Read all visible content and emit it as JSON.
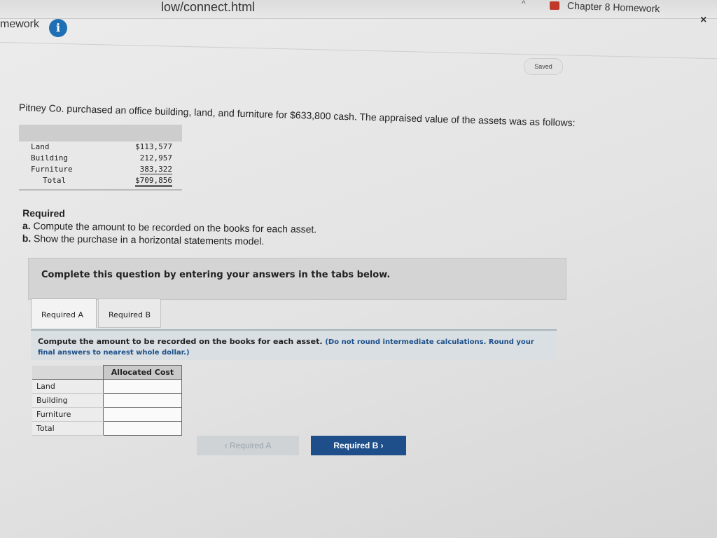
{
  "browser": {
    "url_fragment": "low/connect.html",
    "tab_title": "Chapter 8 Homework",
    "close_symbol": "×"
  },
  "header": {
    "title": "mework",
    "info_symbol": "i",
    "saved_label": "Saved"
  },
  "problem": {
    "statement": "Pitney Co. purchased an office building, land, and furniture for $633,800 cash. The appraised value of the assets was as follows:",
    "values": [
      {
        "label": "Land",
        "amount": "$113,577"
      },
      {
        "label": "Building",
        "amount": "212,957"
      },
      {
        "label": "Furniture",
        "amount": "383,322"
      },
      {
        "label": "Total",
        "amount": "$709,856"
      }
    ]
  },
  "required": {
    "heading": "Required",
    "a_prefix": "a.",
    "a_text": "Compute the amount to be recorded on the books for each asset.",
    "b_prefix": "b.",
    "b_text": "Show the purchase in a horizontal statements model."
  },
  "instructions": "Complete this question by entering your answers in the tabs below.",
  "tabs": [
    "Required A",
    "Required B"
  ],
  "question": {
    "text": "Compute the amount to be recorded on the books for each asset.",
    "note": "(Do not round intermediate calculations. Round your final answers to nearest whole dollar.)"
  },
  "answer_table": {
    "header": "Allocated Cost",
    "rows": [
      "Land",
      "Building",
      "Furniture",
      "Total"
    ]
  },
  "nav": {
    "prev_label": "‹ Required A",
    "next_label": "Required B ›"
  }
}
